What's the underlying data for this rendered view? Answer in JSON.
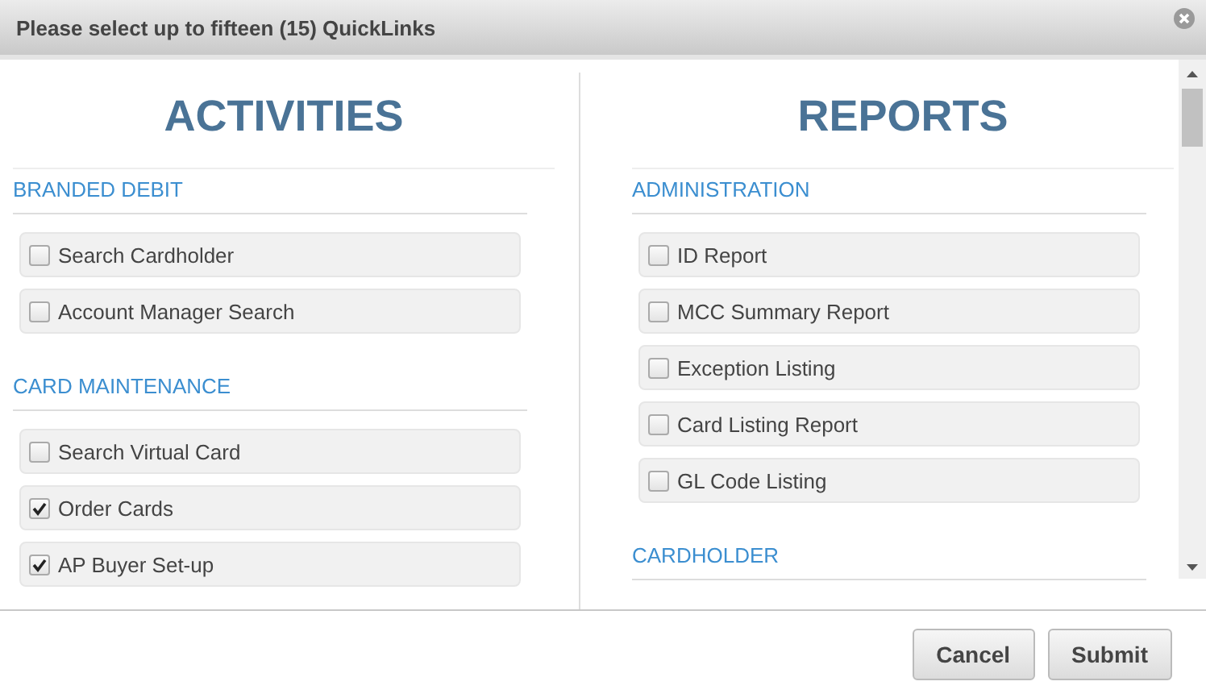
{
  "window": {
    "title": "Please select up to fifteen (15) QuickLinks"
  },
  "columns": [
    {
      "heading": "ACTIVITIES",
      "sections": [
        {
          "title": "BRANDED DEBIT",
          "items": [
            {
              "label": "Search Cardholder",
              "checked": false
            },
            {
              "label": "Account Manager Search",
              "checked": false
            }
          ]
        },
        {
          "title": "CARD MAINTENANCE",
          "items": [
            {
              "label": "Search Virtual Card",
              "checked": false
            },
            {
              "label": "Order Cards",
              "checked": true
            },
            {
              "label": "AP Buyer Set-up",
              "checked": true
            }
          ]
        }
      ]
    },
    {
      "heading": "REPORTS",
      "sections": [
        {
          "title": "ADMINISTRATION",
          "items": [
            {
              "label": "ID Report",
              "checked": false
            },
            {
              "label": "MCC Summary Report",
              "checked": false
            },
            {
              "label": "Exception Listing",
              "checked": false
            },
            {
              "label": "Card Listing Report",
              "checked": false
            },
            {
              "label": "GL Code Listing",
              "checked": false
            }
          ]
        },
        {
          "title": "CARDHOLDER"
        }
      ]
    }
  ],
  "buttons": [
    {
      "label": "Cancel"
    },
    {
      "label": "Submit"
    }
  ]
}
